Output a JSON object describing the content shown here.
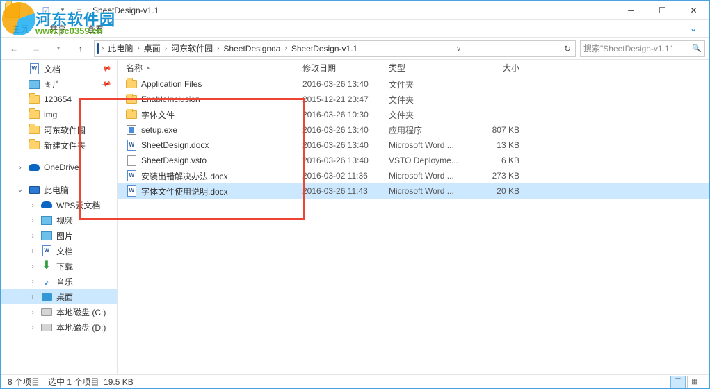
{
  "window": {
    "title": "SheetDesign-v1.1"
  },
  "ribbon": {
    "tabs": [
      "主页",
      "共享",
      "查看"
    ]
  },
  "breadcrumb": {
    "items": [
      "此电脑",
      "桌面",
      "河东软件园",
      "SheetDesignda",
      "SheetDesign-v1.1"
    ],
    "search_placeholder": "搜索\"SheetDesign-v1.1\""
  },
  "columns": {
    "name": "名称",
    "date": "修改日期",
    "type": "类型",
    "size": "大小"
  },
  "sidebar": {
    "quick": [
      {
        "label": "文档",
        "icon": "doc",
        "pinned": true
      },
      {
        "label": "图片",
        "icon": "pic",
        "pinned": true
      },
      {
        "label": "123654",
        "icon": "folder"
      },
      {
        "label": "img",
        "icon": "folder"
      },
      {
        "label": "河东软件园",
        "icon": "folder"
      },
      {
        "label": "新建文件夹",
        "icon": "folder"
      }
    ],
    "onedrive": "OneDrive",
    "thispc": "此电脑",
    "pcitems": [
      {
        "label": "WPS云文档",
        "icon": "onedrive"
      },
      {
        "label": "视频",
        "icon": "pic"
      },
      {
        "label": "图片",
        "icon": "pic"
      },
      {
        "label": "文档",
        "icon": "doc"
      },
      {
        "label": "下载",
        "icon": "dl"
      },
      {
        "label": "音乐",
        "icon": "music"
      },
      {
        "label": "桌面",
        "icon": "desktop",
        "selected": true
      },
      {
        "label": "本地磁盘 (C:)",
        "icon": "drive"
      },
      {
        "label": "本地磁盘 (D:)",
        "icon": "drive"
      }
    ]
  },
  "files": [
    {
      "name": "Application Files",
      "date": "2016-03-26 13:40",
      "type": "文件夹",
      "size": "",
      "icon": "folder"
    },
    {
      "name": "EnableInclusion",
      "date": "2015-12-21 23:47",
      "type": "文件夹",
      "size": "",
      "icon": "folder"
    },
    {
      "name": "字体文件",
      "date": "2016-03-26 10:30",
      "type": "文件夹",
      "size": "",
      "icon": "folder"
    },
    {
      "name": "setup.exe",
      "date": "2016-03-26 13:40",
      "type": "应用程序",
      "size": "807 KB",
      "icon": "exe"
    },
    {
      "name": "SheetDesign.docx",
      "date": "2016-03-26 13:40",
      "type": "Microsoft Word ...",
      "size": "13 KB",
      "icon": "doc"
    },
    {
      "name": "SheetDesign.vsto",
      "date": "2016-03-26 13:40",
      "type": "VSTO Deployme...",
      "size": "6 KB",
      "icon": "vsto"
    },
    {
      "name": "安装出错解决办法.docx",
      "date": "2016-03-02 11:36",
      "type": "Microsoft Word ...",
      "size": "273 KB",
      "icon": "doc"
    },
    {
      "name": "字体文件使用说明.docx",
      "date": "2016-03-26 11:43",
      "type": "Microsoft Word ...",
      "size": "20 KB",
      "icon": "doc",
      "selected": true
    }
  ],
  "status": {
    "count": "8 个项目",
    "selection": "选中 1 个项目",
    "selsize": "19.5 KB"
  },
  "watermark": {
    "name": "河东软件园",
    "url": "www.pc0359.cn"
  }
}
